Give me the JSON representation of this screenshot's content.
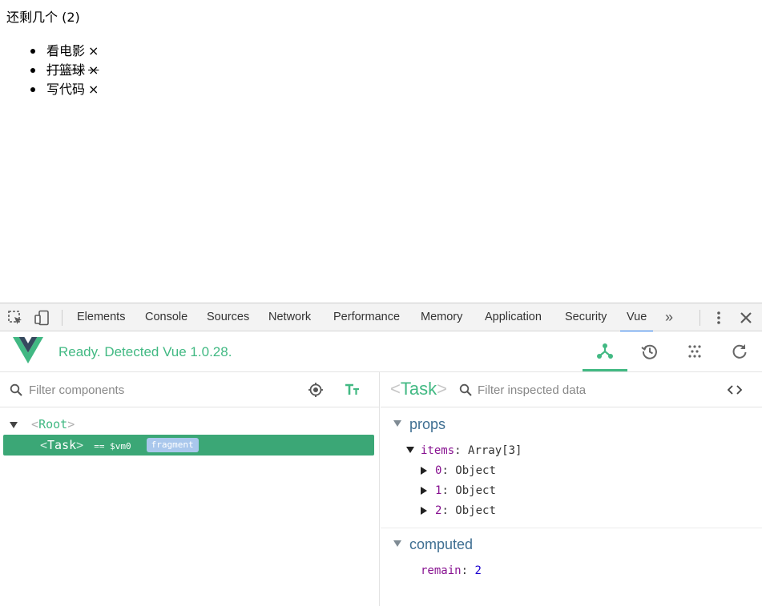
{
  "page": {
    "heading": "还剩几个 (2)",
    "tasks": [
      {
        "text": "看电影",
        "remove": "×",
        "done": false
      },
      {
        "text": "打篮球",
        "remove": "×",
        "done": true
      },
      {
        "text": "写代码",
        "remove": "×",
        "done": false
      }
    ]
  },
  "devtools": {
    "tabs": [
      "Elements",
      "Console",
      "Sources",
      "Network",
      "Performance",
      "Memory",
      "Application",
      "Security",
      "Vue"
    ],
    "active_tab": "Vue",
    "more": "»",
    "vue": {
      "status": "Ready. Detected Vue 1.0.28.",
      "accent": "#42b983",
      "filter_components_placeholder": "Filter components",
      "filter_data_placeholder": "Filter inspected data",
      "tree": {
        "root": {
          "open": "<",
          "name": "Root",
          "close": ">"
        },
        "selected": {
          "open": "<",
          "name": "Task",
          "close": ">",
          "ref": "== $vm0",
          "badge": "fragment"
        }
      },
      "inspected": {
        "open": "<",
        "name": "Task",
        "close": ">"
      },
      "props_label": "props",
      "items_key": "items",
      "items_value": "Array[3]",
      "items": [
        {
          "key": "0",
          "value": "Object"
        },
        {
          "key": "1",
          "value": "Object"
        },
        {
          "key": "2",
          "value": "Object"
        }
      ],
      "computed_label": "computed",
      "remain_key": "remain",
      "remain_value": "2"
    }
  }
}
